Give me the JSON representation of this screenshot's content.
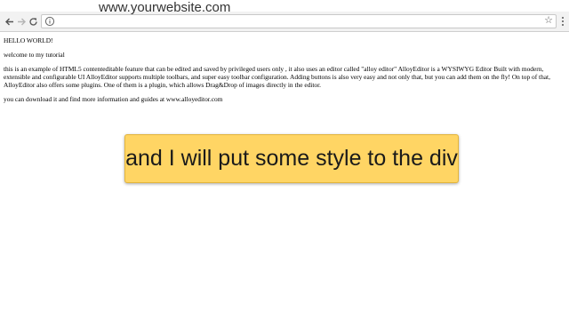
{
  "watermark": "www.yourwebsite.com",
  "browser": {
    "icons": {
      "back": "arrow-left-icon",
      "forward": "arrow-right-icon",
      "reload": "reload-icon",
      "info": "info-icon",
      "bookmark": "star-icon",
      "menu": "kebab-menu-icon"
    },
    "address_value": ""
  },
  "page": {
    "heading": "HELLO WORLD!",
    "welcome": "welcome to my tutorial",
    "description": "this is an example of HTML5 contenteditable feature that can be edited and saved by privileged users only , it also uses an editor called \"alloy editor\" AlloyEditor is a WYSIWYG Editor Built with modern, extensible and configurable UI AlloyEditor supports multiple toolbars, and super easy toolbar configuration. Adding buttons is also very easy and not only that, but you can add them on the fly! On top of that, AlloyEditor also offers some plugins. One of them is a plugin, which allows Drag&Drop of images directly in the editor.",
    "download": "you can download it and find more information and guides at www.alloyeditor.com",
    "styled_box_text": "and I will put some style to the div"
  },
  "colors": {
    "styled_box_background": "#ffd564",
    "styled_box_border": "#e2b43c",
    "toolbar_background": "#f2f2f2"
  }
}
